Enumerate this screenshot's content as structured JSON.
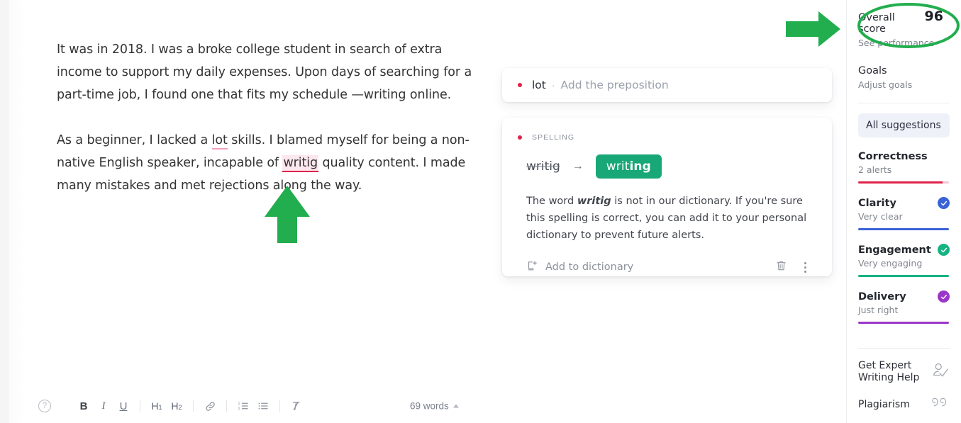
{
  "document": {
    "paragraphs": [
      {
        "id": "p1",
        "segments": [
          {
            "text": "It was in 2018. I was a broke college student in search of extra income to support my daily expenses. Upon days of searching for a part-time job, I found one that fits my schedule —writing online.",
            "style": "plain"
          }
        ]
      },
      {
        "id": "p2",
        "segments": [
          {
            "text": "As a beginner, I lacked a ",
            "style": "plain"
          },
          {
            "text": "lot",
            "style": "underline-suggestion"
          },
          {
            "text": " skills. I blamed myself for being a non-native English speaker, incapable of ",
            "style": "plain"
          },
          {
            "text": "writig",
            "style": "spelling-error"
          },
          {
            "text": " quality content. I made many mistakes and met rejections along the way.",
            "style": "plain"
          }
        ]
      }
    ]
  },
  "toolbar": {
    "help_icon": "help-circle-icon",
    "bold_label": "B",
    "italic_label": "I",
    "underline_label": "U",
    "h1_label": "H",
    "h1_sub": "1",
    "h2_label": "H",
    "h2_sub": "2",
    "link_icon": "link-icon",
    "ordered_list_icon": "numbered-list-icon",
    "bullet_list_icon": "bullet-list-icon",
    "clear_format_icon": "clear-formatting-icon",
    "word_count": "69 words"
  },
  "cards": {
    "mini": {
      "word": "lot",
      "separator": "·",
      "hint": "Add the preposition",
      "dot_color": "#e0224a"
    },
    "main": {
      "category": "SPELLING",
      "dot_color": "#e0224a",
      "original": "writig",
      "arrow": "→",
      "replacement_prefix": "writ",
      "replacement_bold": "ing",
      "replacement_full": "writing",
      "replacement_bg": "#18a878",
      "explanation_prefix": "The word ",
      "explanation_word": "writig",
      "explanation_suffix": " is not in our dictionary. If you're sure this spelling is correct, you can add it to your personal dictionary to prevent future alerts.",
      "add_to_dictionary": "Add to dictionary",
      "add_icon": "add-to-dictionary-icon",
      "delete_icon": "trash-icon",
      "more_icon": "kebab-menu-icon"
    }
  },
  "sidebar": {
    "score": {
      "label": "Overall score",
      "value": "96",
      "sub": "See performance"
    },
    "goals": {
      "label": "Goals",
      "sub": "Adjust goals"
    },
    "all_suggestions": "All suggestions",
    "metrics": [
      {
        "name": "Correctness",
        "sub": "2 alerts",
        "bar_color": "#e0224a",
        "bar_tail_color": "#f6c7d3",
        "bar_fill_pct": 93,
        "has_check": false,
        "check_color": ""
      },
      {
        "name": "Clarity",
        "sub": "Very clear",
        "bar_color": "#3a63d8",
        "bar_tail_color": "",
        "bar_fill_pct": 100,
        "has_check": true,
        "check_color": "#3a63d8"
      },
      {
        "name": "Engagement",
        "sub": "Very engaging",
        "bar_color": "#17b383",
        "bar_tail_color": "",
        "bar_fill_pct": 100,
        "has_check": true,
        "check_color": "#17b383"
      },
      {
        "name": "Delivery",
        "sub": "Just right",
        "bar_color": "#9b36c9",
        "bar_tail_color": "",
        "bar_fill_pct": 100,
        "has_check": true,
        "check_color": "#9b36c9"
      }
    ],
    "links": [
      {
        "label": "Get Expert Writing Help",
        "icon": "person-check-icon"
      },
      {
        "label": "Plagiarism",
        "icon": "quotation-marks-icon"
      }
    ]
  },
  "annotations": {
    "color": "#22ae4e",
    "arrow_right": "green-right-arrow-annotation",
    "arrow_up": "green-up-arrow-annotation",
    "ellipse": "green-ellipse-annotation"
  }
}
